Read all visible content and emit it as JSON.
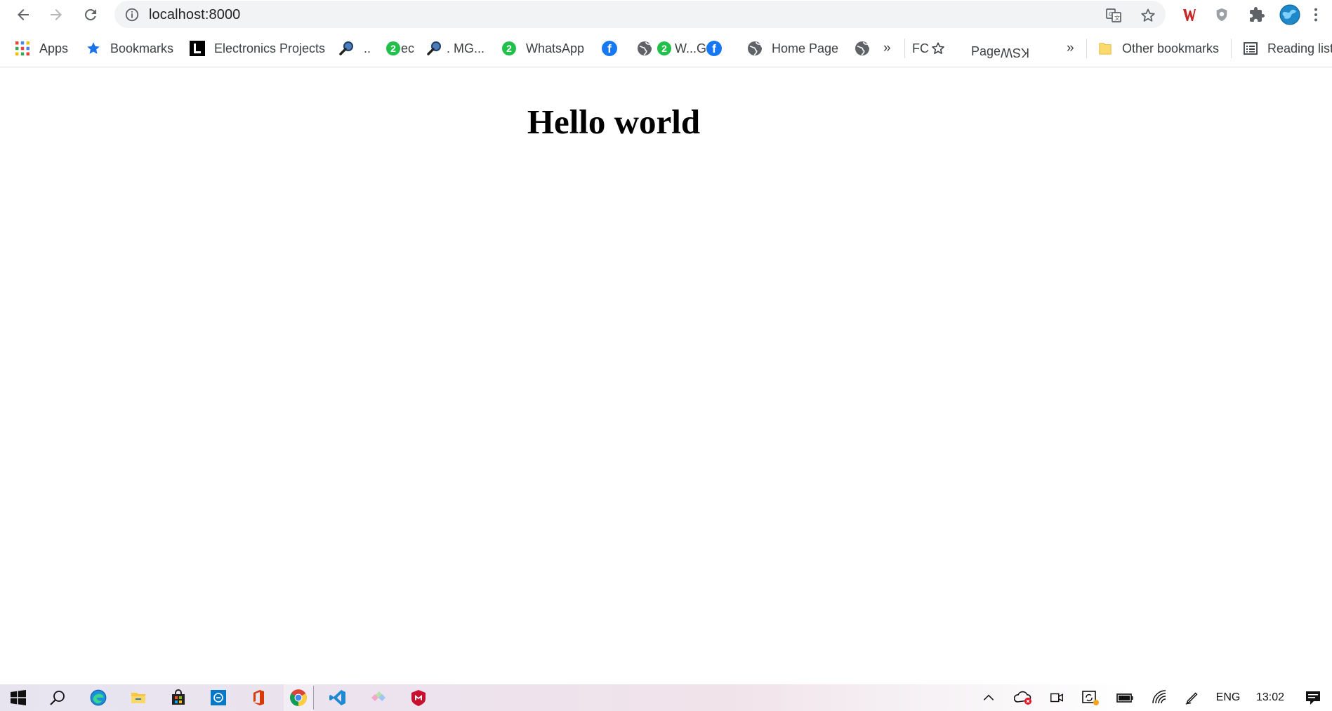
{
  "browser": {
    "url": "localhost:8000"
  },
  "bookmarks": {
    "items": [
      {
        "label": "Apps"
      },
      {
        "label": "Bookmarks"
      },
      {
        "label": "Electronics Projects"
      },
      {
        "label": ".."
      },
      {
        "label": "ec"
      },
      {
        "label": ". MG..."
      },
      {
        "label": "WhatsApp"
      },
      {
        "label": "W...G"
      },
      {
        "label": "Home Page"
      },
      {
        "label": "FC"
      },
      {
        "label": "Page"
      },
      {
        "label": "KSW"
      }
    ],
    "more_1": "»",
    "more_2": "»",
    "other": "Other bookmarks",
    "reading": "Reading list"
  },
  "page": {
    "heading": "Hello world"
  },
  "taskbar": {
    "language": "ENG",
    "time": "13:02"
  },
  "colors": {
    "accent_blue": "#1a73e8",
    "whatsapp_green": "#20c04a",
    "facebook_blue": "#1877f2",
    "mcafee_red": "#c8102e"
  }
}
